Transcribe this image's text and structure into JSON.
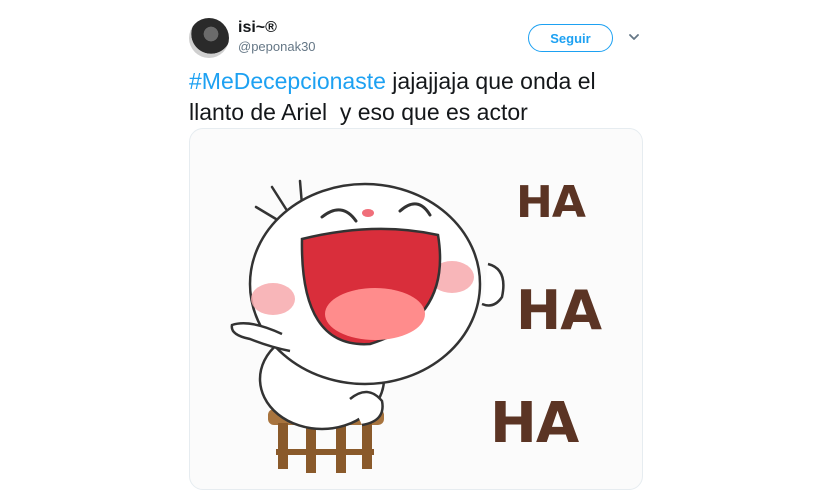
{
  "author": {
    "name": "isi~®",
    "handle": "@peponak30"
  },
  "follow": {
    "label": "Seguir"
  },
  "tweet": {
    "hashtag": "#MeDecepcionaste",
    "text": " jajajjaja que onda el llanto de Ariel  y eso que es actor"
  },
  "media": {
    "laugh_1": "HA",
    "laugh_2": "HA",
    "laugh_3": "HA",
    "laugh_color": "#5b3424"
  },
  "colors": {
    "accent": "#1da1f2",
    "text": "#14171a",
    "muted": "#657786"
  },
  "icons": {
    "menu": "chevron-down-icon"
  }
}
